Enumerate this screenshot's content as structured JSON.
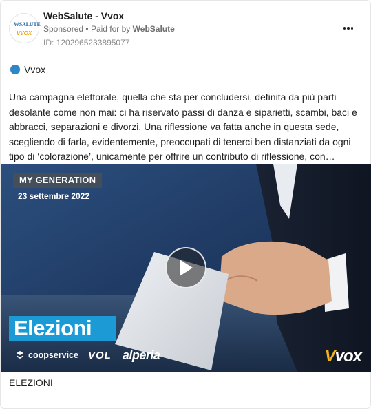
{
  "header": {
    "page_name": "WebSalute - Vvox",
    "sponsored_label": "Sponsored",
    "paid_for_prefix": "Paid for by",
    "advertiser": "WebSalute",
    "ad_id": "ID: 1202965233895077",
    "avatar_text_top": "WSALUTE",
    "avatar_text_bottom": "VVOX"
  },
  "tag": {
    "label": "Vvox",
    "dot_color": "#2f86c7"
  },
  "body": {
    "text": "Una campagna elettorale, quella che sta per concludersi, definita da più parti desolante come non mai: ci ha riservato passi di danza e siparietti, scambi, baci e abbracci, separazioni e divorzi. Una riflessione va fatta anche in questa sede, scegliendo di farla, evidentemente, preoccupati di tenerci ben distanziati da ogni tipo di ‘colorazione’, unicamente per offrire un contributo di riflessione, con…"
  },
  "media": {
    "badge_title": "MY GENERATION",
    "badge_date": "23 settembre 2022",
    "banner": "Elezioni",
    "sponsors": [
      "coopservice",
      "VOL",
      "alperia"
    ],
    "brand_logo": "Vvox",
    "play_icon": "play-icon",
    "banner_color": "#1b9ad6"
  },
  "caption": "ELEZIONI",
  "icons": {
    "more": "more-horizontal-icon",
    "tag_dot": "circle-dot-icon"
  }
}
